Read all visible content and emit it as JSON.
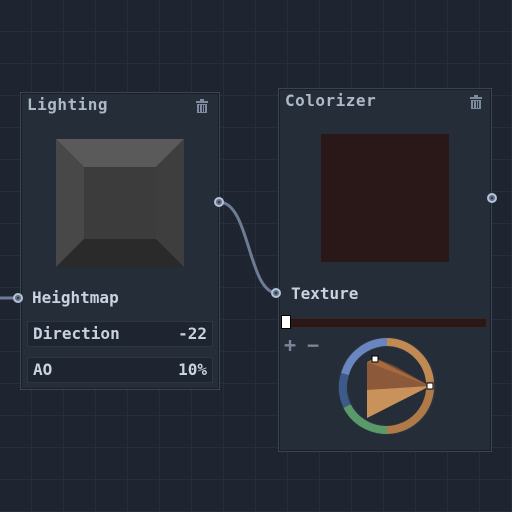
{
  "lighting": {
    "title": "Lighting",
    "input_label": "Heightmap",
    "fields": [
      {
        "name": "Direction",
        "value": "-22"
      },
      {
        "name": "AO",
        "value": "10%"
      }
    ]
  },
  "colorizer": {
    "title": "Colorizer",
    "input_label": "Texture",
    "add_label": "+",
    "remove_label": "−",
    "swatch_color": "#2a1818"
  },
  "icons": {
    "delete": "trash-icon",
    "port": "port-icon"
  },
  "colors": {
    "background": "#1e2430",
    "node": "#252d39",
    "wire": "#6e7c93"
  }
}
